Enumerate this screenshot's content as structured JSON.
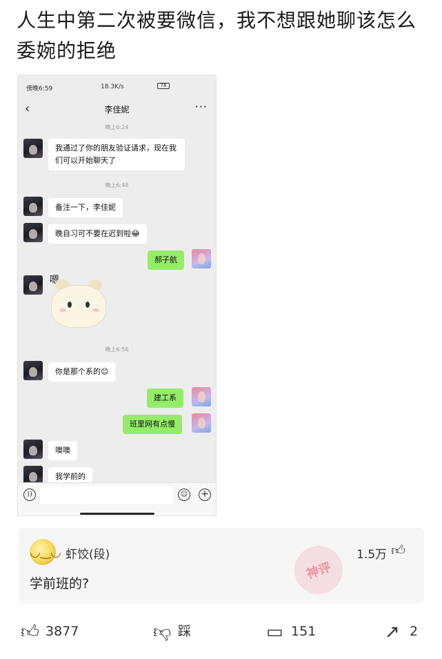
{
  "post": {
    "title": "人生中第二次被要微信，我不想跟她聊该怎么委婉的拒绝"
  },
  "phone": {
    "status": {
      "time": "傍晚6:59",
      "network": "18.3K/s",
      "battery": "78"
    },
    "chat_title": "李佳妮",
    "messages": [
      {
        "type": "time",
        "text": "晚上6:24"
      },
      {
        "type": "in",
        "text": "我通过了你的朋友验证请求，现在我们可以开始聊天了"
      },
      {
        "type": "time",
        "text": "晚上6:48"
      },
      {
        "type": "in",
        "text": "备注一下，李佳妮"
      },
      {
        "type": "in",
        "text": "晚自习可不要在迟到啦😂"
      },
      {
        "type": "out",
        "text": "郝子航"
      },
      {
        "type": "sticker",
        "text": "嗯"
      },
      {
        "type": "time",
        "text": "晚上6:56"
      },
      {
        "type": "in",
        "text": "你是那个系的😊"
      },
      {
        "type": "out",
        "text": "建工系"
      },
      {
        "type": "out",
        "text": "班里网有点慢"
      },
      {
        "type": "in",
        "text": "噢噢"
      },
      {
        "type": "in",
        "text": "我学前的"
      }
    ]
  },
  "comment": {
    "user": "虾饺(段)",
    "likes": "1.5万",
    "text": "学前班的?",
    "stamp": "神评"
  },
  "actions": {
    "like_count": "3877",
    "dislike_label": "踩",
    "comment_count": "151",
    "share_count": "2"
  }
}
